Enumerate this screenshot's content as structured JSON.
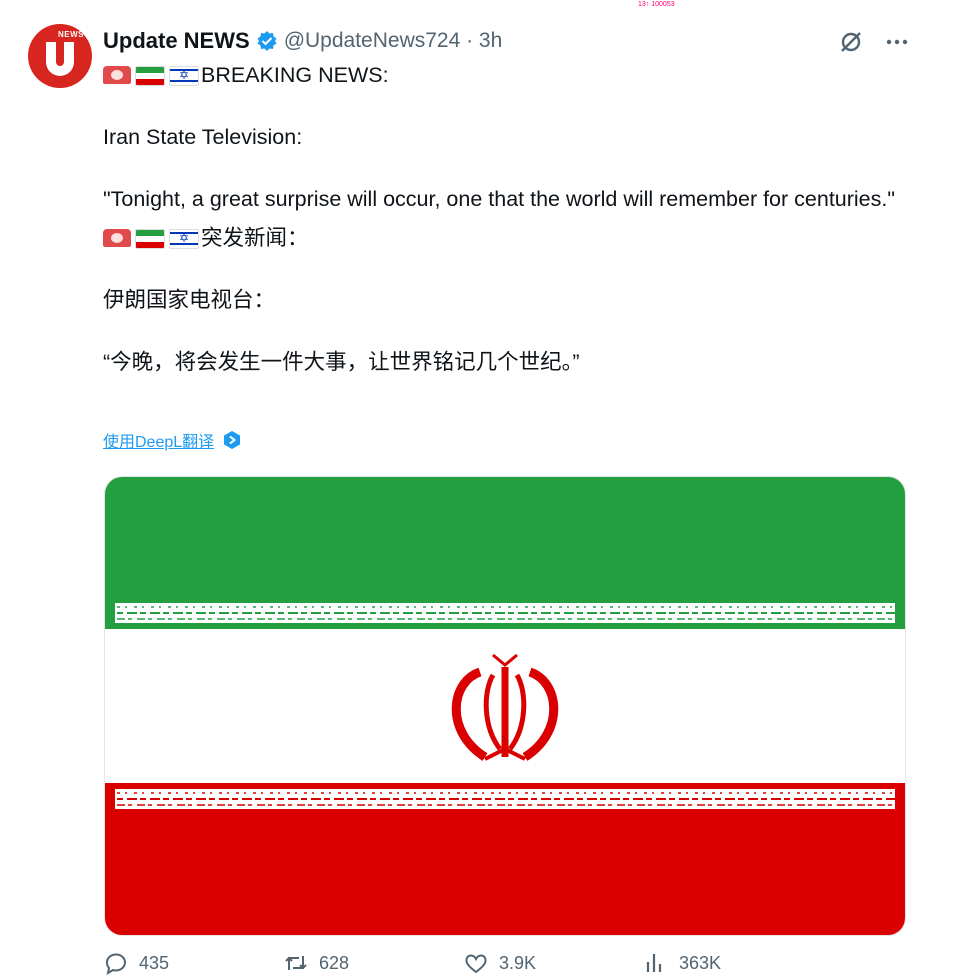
{
  "top_note": "13↑ 100053",
  "tweet": {
    "author_name": "Update NEWS",
    "handle_time": "@UpdateNews724 · 3h",
    "avatar_label": "NEWS",
    "lines": [
      "BREAKING NEWS:",
      "",
      "Iran State Television:",
      "",
      "\"Tonight, a great surprise will occur, one that the world will remember for centuries.\""
    ],
    "cn_heading": "突发新闻：",
    "cn_source": "伊朗国家电视台：",
    "cn_quote": "“今晚，将会发生一件大事，让世界铭记几个世纪。”",
    "translate_label": "使用DeepL翻译"
  },
  "actions": {
    "replies": "435",
    "retweets": "628",
    "likes": "3.9K",
    "views": "363K"
  },
  "icons": [
    "verified-badge-icon",
    "grok-icon",
    "more-icon",
    "reply-icon",
    "retweet-icon",
    "like-icon",
    "views-icon",
    "deepl-icon",
    "siren-emoji",
    "iran-flag-emoji",
    "israel-flag-emoji"
  ],
  "colors": {
    "accent": "#1d9bf0",
    "iran_green": "#239f40",
    "iran_red": "#da0000",
    "avatar_red": "#d6261f"
  }
}
